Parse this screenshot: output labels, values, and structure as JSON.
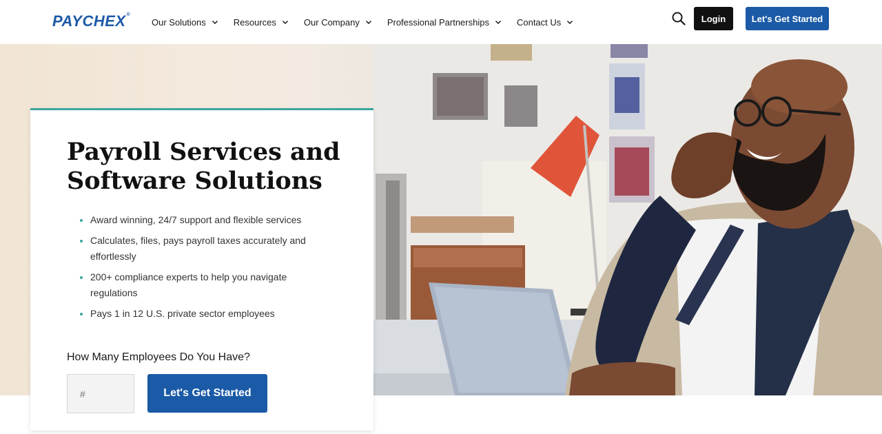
{
  "header": {
    "logo": "PAYCHEX",
    "nav": [
      {
        "label": "Our Solutions"
      },
      {
        "label": "Resources"
      },
      {
        "label": "Our Company"
      },
      {
        "label": "Professional Partnerships"
      },
      {
        "label": "Contact Us"
      }
    ],
    "login_label": "Login",
    "cta_label": "Let's Get Started"
  },
  "hero": {
    "title": "Payroll Services and Software Solutions",
    "bullets": [
      "Award winning, 24/7 support and flexible services",
      "Calculates, files, pays payroll taxes accurately and effortlessly",
      "200+ compliance experts to help you navigate regulations",
      "Pays 1 in 12 U.S. private sector employees"
    ],
    "question": "How Many Employees Do You Have?",
    "input_placeholder": "#",
    "cta_label": "Let's Get Started"
  },
  "colors": {
    "brand_blue": "#1a5aa6",
    "logo_blue": "#1d5aa8",
    "accent_teal": "#3aa6a0",
    "login_black": "#111111"
  },
  "icons": {
    "search": "search-icon",
    "chevron": "chevron-down-icon"
  }
}
